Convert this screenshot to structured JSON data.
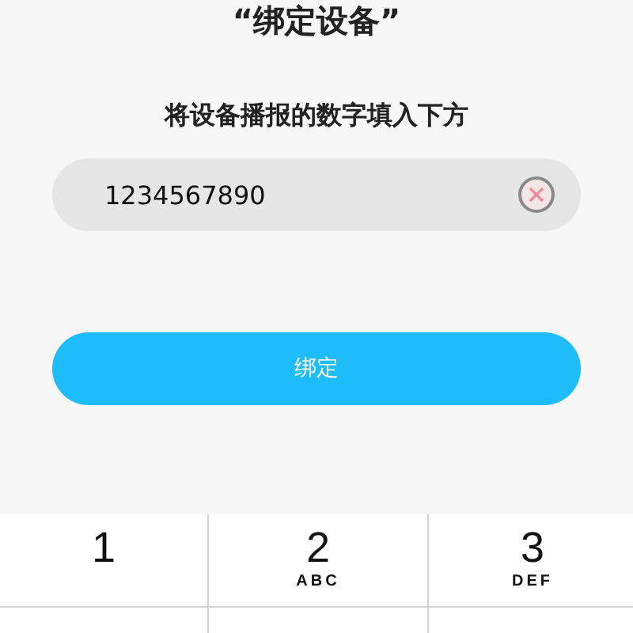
{
  "title": "“绑定设备”",
  "instruction": "将设备播报的数字填入下方",
  "code_field": {
    "value": "1234567890"
  },
  "bind_button": {
    "label": "绑定"
  },
  "keypad": [
    {
      "digit": "1"
    },
    {
      "digit": "2",
      "letters": "ABC"
    },
    {
      "digit": "3",
      "letters": "DEF"
    }
  ]
}
